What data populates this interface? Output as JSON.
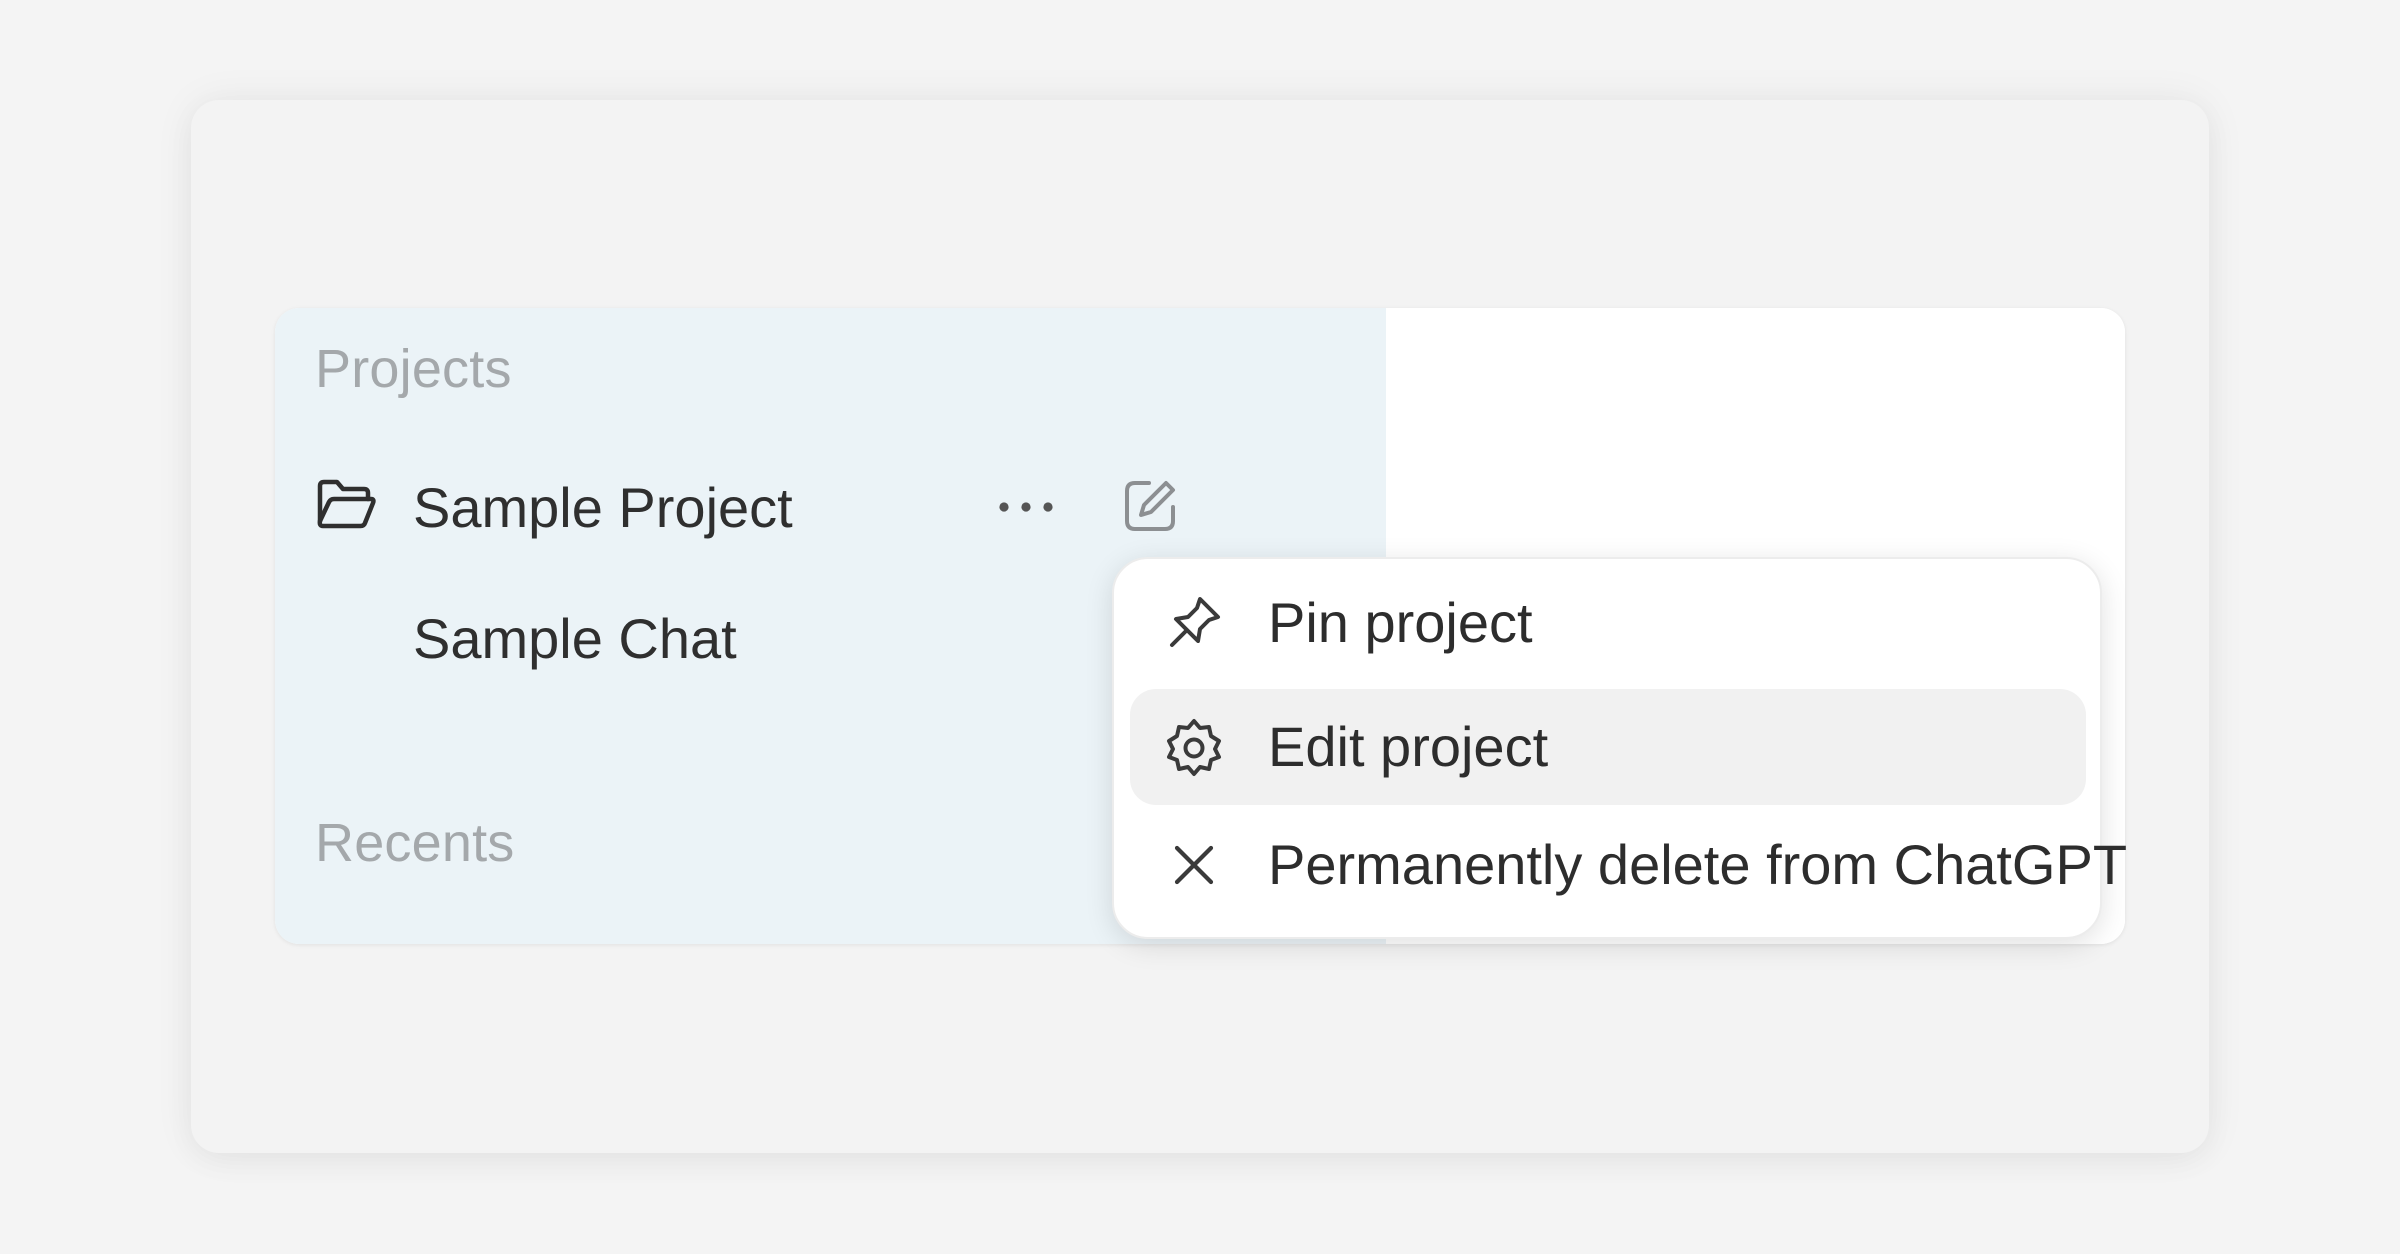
{
  "sidebar": {
    "projects_title": "Projects",
    "recents_title": "Recents",
    "project": {
      "label": "Sample Project",
      "icon": "folder-open-icon",
      "more_icon": "ellipsis-icon",
      "compose_icon": "compose-icon"
    },
    "chat": {
      "label": "Sample Chat"
    }
  },
  "menu": {
    "items": [
      {
        "label": "Pin project",
        "icon": "pin-icon"
      },
      {
        "label": "Edit project",
        "icon": "gear-icon",
        "highlighted": true
      },
      {
        "label": "Permanently delete from ChatGPT",
        "icon": "close-icon"
      }
    ]
  },
  "colors": {
    "sidebar_bg": "#ebf3f7",
    "menu_hover_bg": "#f1f1f1",
    "muted_text": "#a4a8ab",
    "text": "#2f2f2f"
  }
}
